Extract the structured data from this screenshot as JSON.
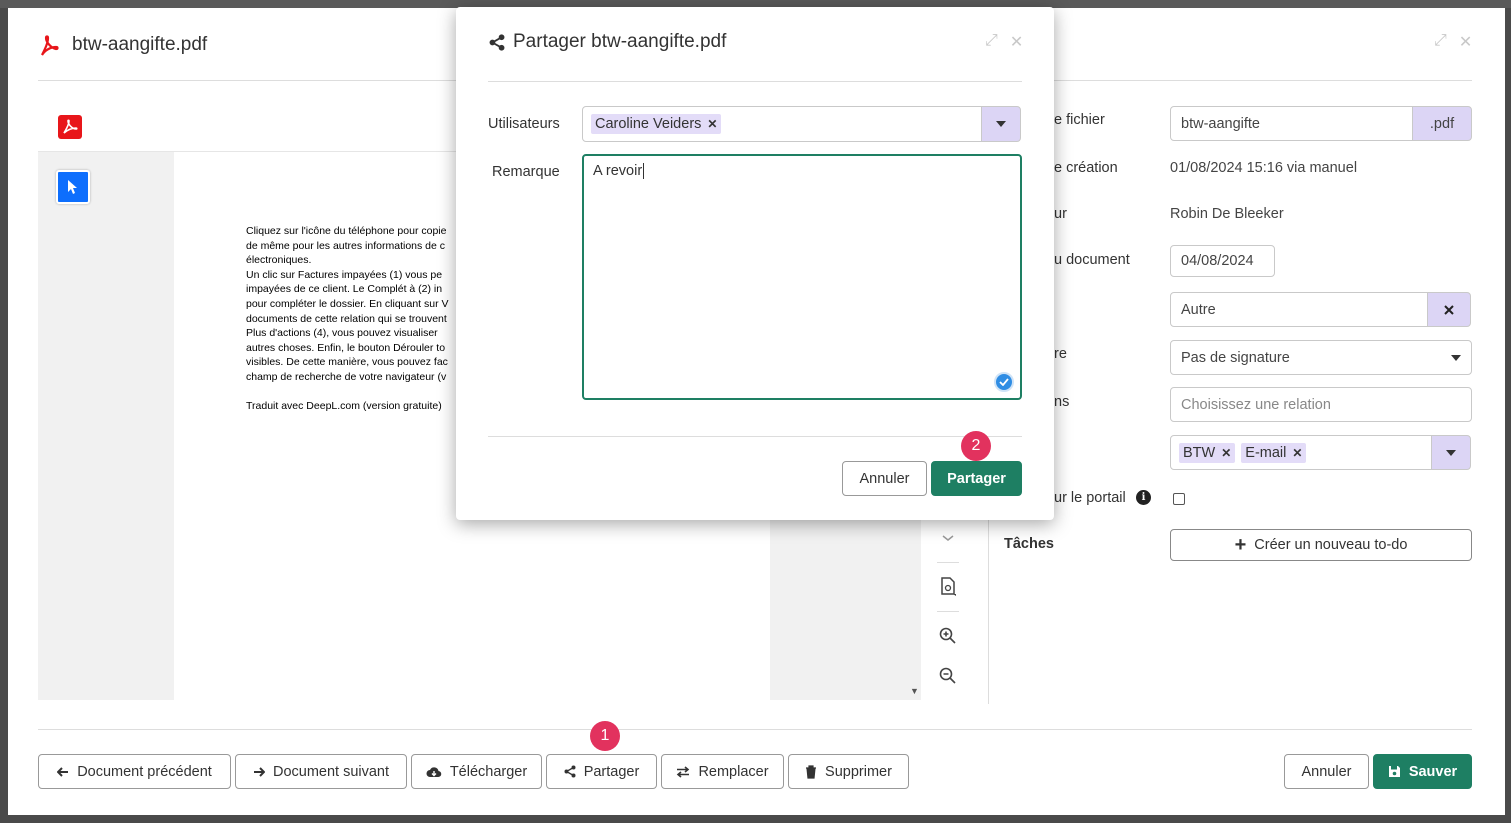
{
  "main": {
    "title": "btw-aangifte.pdf",
    "document_text": [
      "Cliquez sur l'icône du téléphone pour copie",
      "de même pour les autres informations de c",
      "électroniques.",
      "Un clic sur Factures impayées (1) vous pe",
      "impayées de ce client. Le Complét à (2) in",
      "pour compléter le dossier. En cliquant sur V",
      "documents de cette relation qui se trouvent",
      "Plus d'actions (4), vous pouvez visualiser",
      "autres choses. Enfin, le bouton Dérouler to",
      "visibles. De cette manière, vous pouvez fac",
      "champ de recherche de votre navigateur (v",
      "",
      "Traduit avec DeepL.com (version gratuite)"
    ],
    "form": {
      "filename_label": "e fichier",
      "filename_value": "btw-aangifte",
      "extension": ".pdf",
      "created_label": "e création",
      "created_value": "01/08/2024 15:16 via manuel",
      "author_label": "ur",
      "author_value": "Robin De Bleeker",
      "docdate_label": "u document",
      "docdate_value": "04/08/2024",
      "type_value": "Autre",
      "signature_label": "re",
      "signature_value": "Pas de signature",
      "relations_label": "ns",
      "relations_placeholder": "Choisissez une relation",
      "tags": [
        "BTW",
        "E-mail"
      ],
      "portal_label": "ur le portail",
      "tasks_label": "Tâches",
      "new_todo": "Créer un nouveau to-do"
    },
    "footer": {
      "prev": "Document précédent",
      "next": "Document suivant",
      "download": "Télécharger",
      "share": "Partager",
      "replace": "Remplacer",
      "delete": "Supprimer",
      "cancel": "Annuler",
      "save": "Sauver"
    },
    "badge1": "1"
  },
  "share_dialog": {
    "title": "Partager btw-aangifte.pdf",
    "users_label": "Utilisateurs",
    "users": [
      "Caroline Veiders"
    ],
    "remark_label": "Remarque",
    "remark_value": "A revoir",
    "cancel": "Annuler",
    "submit": "Partager",
    "badge2": "2"
  },
  "colors": {
    "accent": "#1e7f63",
    "badge": "#e2325e",
    "tag": "#e3dcf8",
    "pdf": "#e8161a"
  }
}
